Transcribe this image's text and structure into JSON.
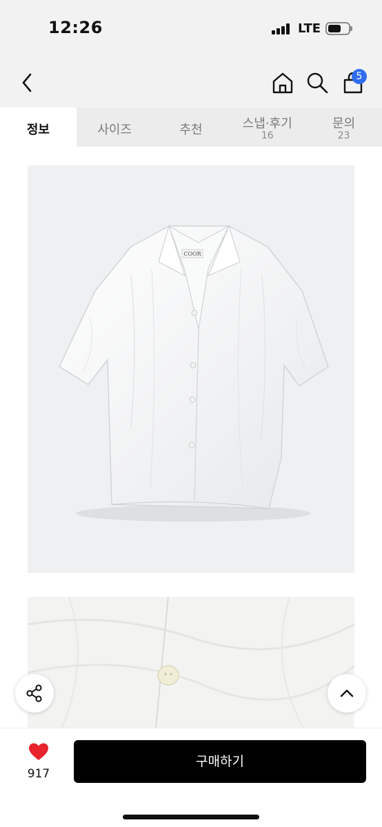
{
  "status_bar": {
    "time": "12:26",
    "network": "LTE",
    "icons": [
      "signal-icon",
      "battery-icon"
    ]
  },
  "nav": {
    "icons": [
      "back-icon",
      "home-icon",
      "search-icon",
      "cart-icon"
    ],
    "cart_badge": "5",
    "accent_color": "#2f6cf0"
  },
  "tabs": [
    {
      "label": "정보",
      "count": "",
      "active": true
    },
    {
      "label": "사이즈",
      "count": ""
    },
    {
      "label": "추천",
      "count": ""
    },
    {
      "label": "스냅·후기",
      "count": "16"
    },
    {
      "label": "문의",
      "count": "23"
    }
  ],
  "product": {
    "label_text": "COOR",
    "images": [
      "white-short-sleeve-shirt",
      "shirt-button-closeup"
    ]
  },
  "floating": {
    "icons": [
      "share-icon",
      "scroll-top-icon"
    ]
  },
  "bottom_bar": {
    "like_count": "917",
    "buy_label": "구매하기",
    "heart_color": "#e8232c"
  }
}
